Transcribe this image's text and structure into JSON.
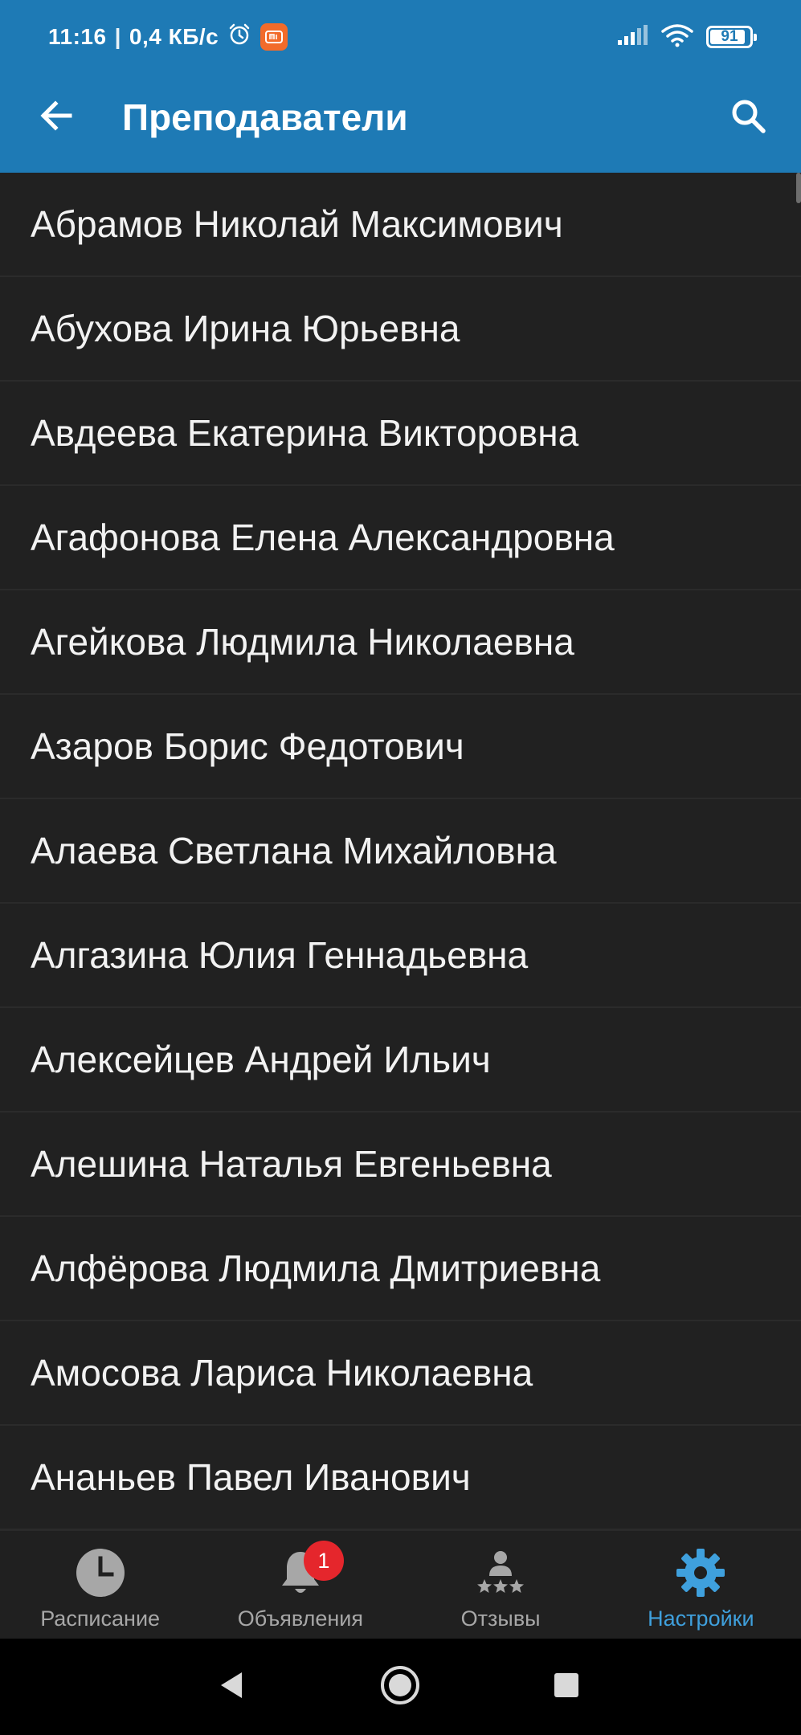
{
  "status_bar": {
    "time": "11:16",
    "separator": "|",
    "speed": "0,4 КБ/с",
    "battery_level": "91",
    "icons": [
      "alarm-clock-icon",
      "mi-app-icon",
      "signal-icon",
      "wifi-icon",
      "battery-icon"
    ]
  },
  "app_bar": {
    "title": "Преподаватели",
    "back_icon": "arrow-back-icon",
    "search_icon": "search-icon"
  },
  "colors": {
    "app_bar": "#1e7ab5",
    "background": "#212121",
    "accent": "#3fa0dd",
    "badge": "#e5262c"
  },
  "teachers": [
    "Абрамов Николай Максимович",
    "Абухова Ирина Юрьевна",
    "Авдеева Екатерина Викторовна",
    "Агафонова Елена Александровна",
    "Агейкова Людмила Николаевна",
    "Азаров Борис Федотович",
    "Алаева Светлана Михайловна",
    "Алгазина Юлия Геннадьевна",
    "Алексейцев Андрей Ильич",
    "Алешина Наталья Евгеньевна",
    "Алфёрова Людмила Дмитриевна",
    "Амосова Лариса Николаевна",
    "Ананьев Павел Иванович"
  ],
  "bottom_nav": {
    "items": [
      {
        "label": "Расписание",
        "icon": "clock-icon",
        "active": false
      },
      {
        "label": "Объявления",
        "icon": "bell-icon",
        "active": false,
        "badge": "1"
      },
      {
        "label": "Отзывы",
        "icon": "reviews-icon",
        "active": false
      },
      {
        "label": "Настройки",
        "icon": "gear-icon",
        "active": true
      }
    ]
  },
  "system_nav": {
    "icons": [
      "back-triangle-icon",
      "home-circle-icon",
      "recents-square-icon"
    ]
  }
}
